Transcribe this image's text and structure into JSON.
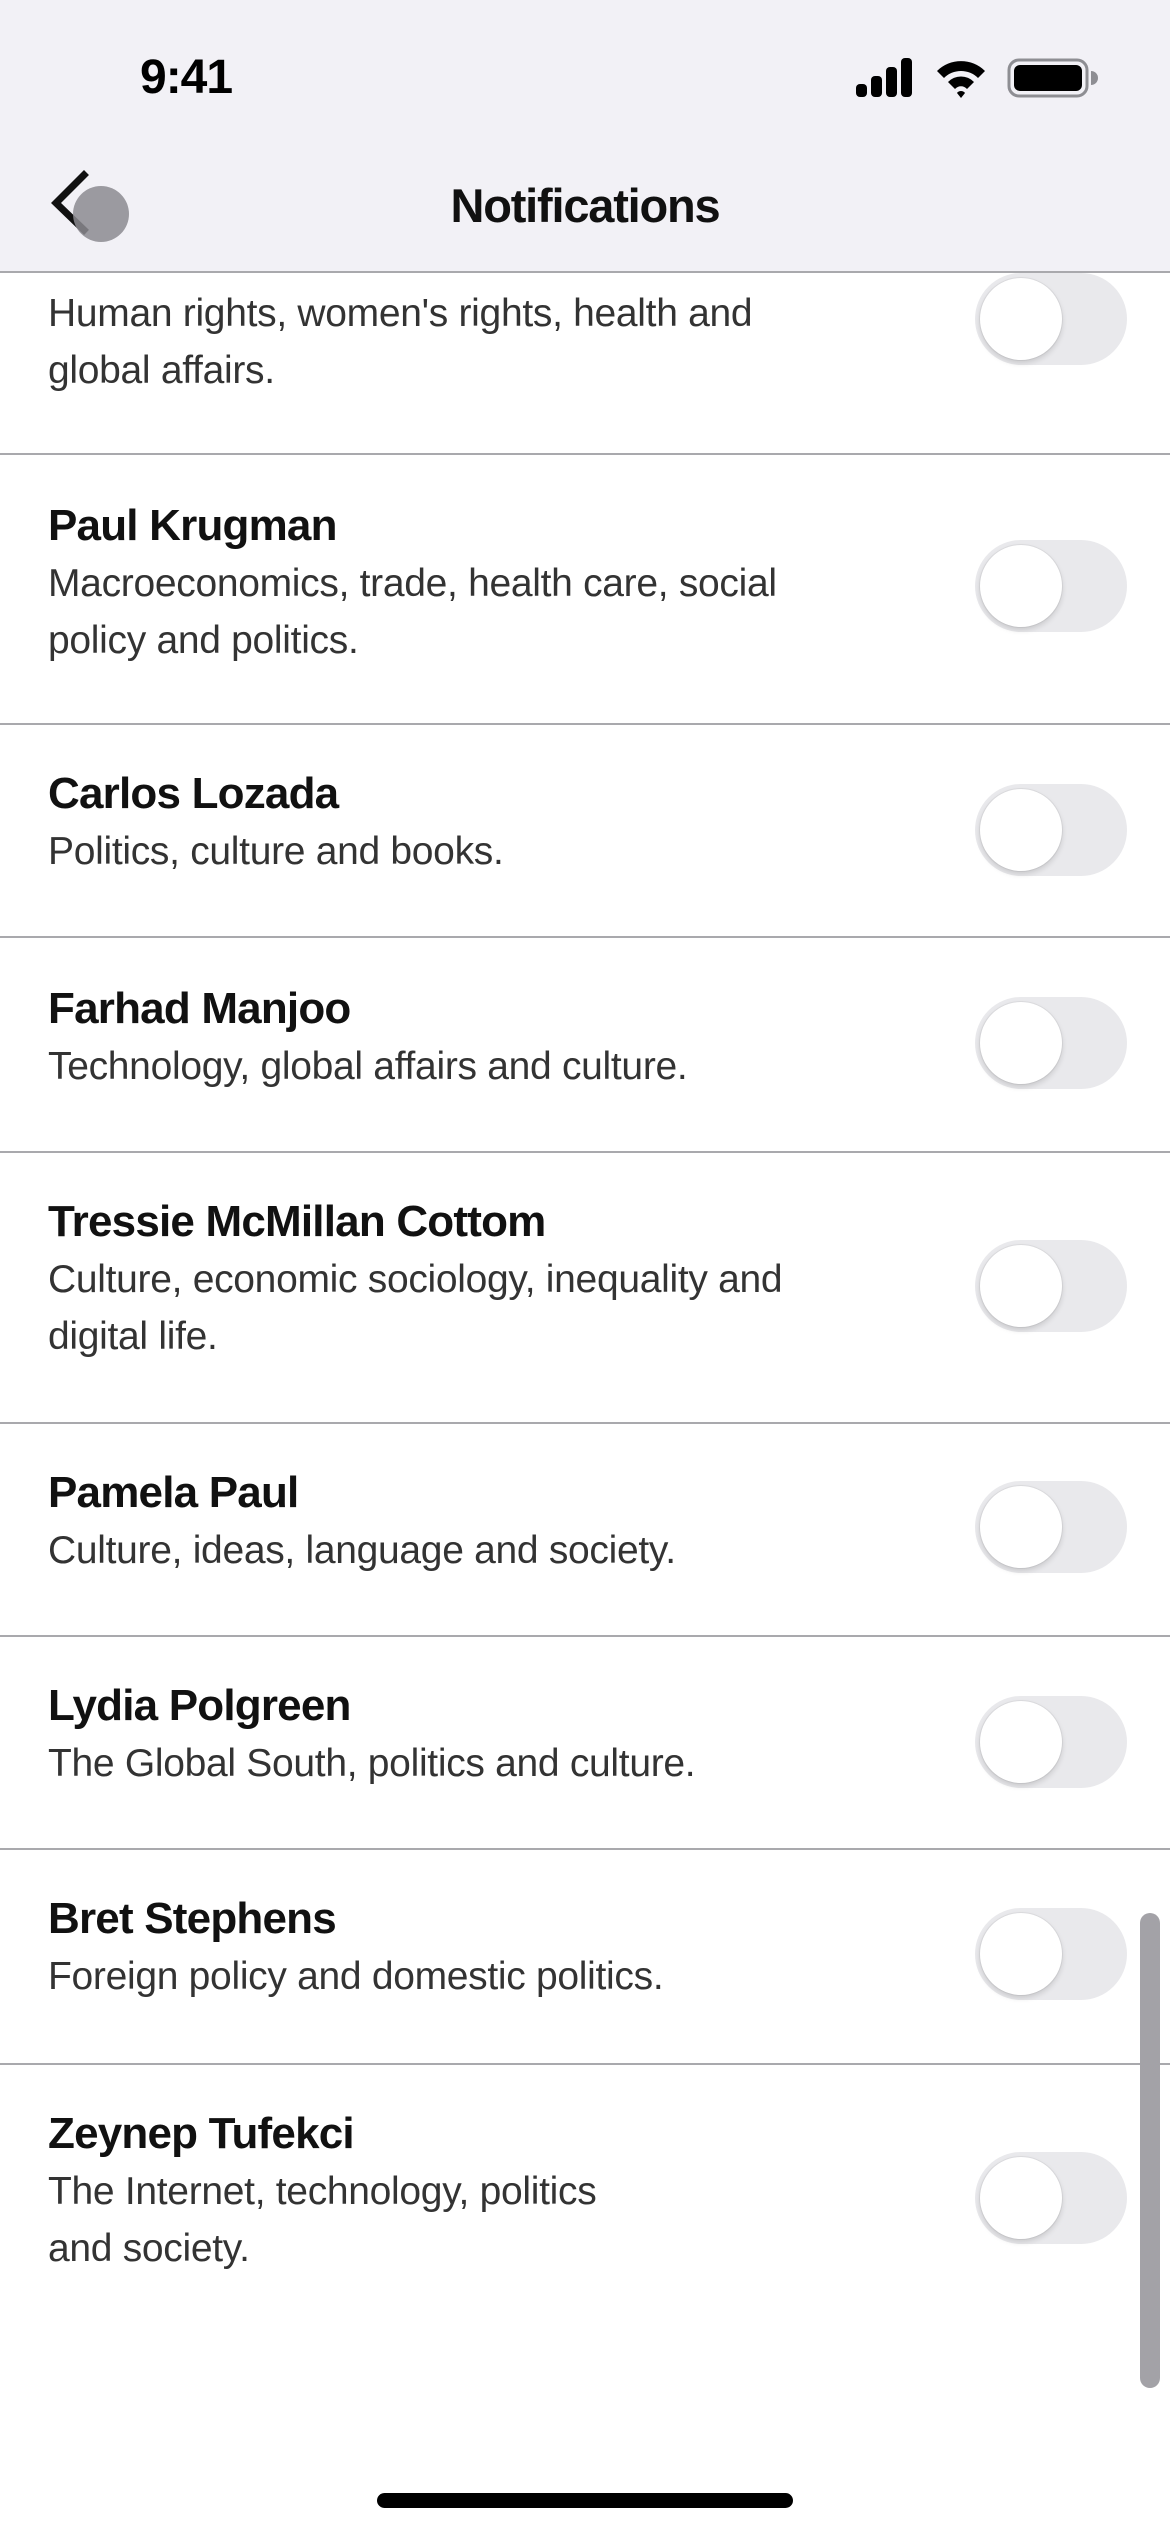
{
  "status_bar": {
    "time": "9:41",
    "icons": [
      "cellular-signal-icon",
      "wifi-icon",
      "battery-full-icon"
    ]
  },
  "nav": {
    "back_icon": "chevron-left-icon",
    "title": "Notifications"
  },
  "colors": {
    "toggle_off_track": "#e9e9ec",
    "toggle_knob": "#ffffff",
    "header_background": "#f2f1f6",
    "divider": "#a9a9ad",
    "scrollbar": "#a3a2a7"
  },
  "columnists": [
    {
      "name": "",
      "description_lines": [
        "Human rights, women's rights, health and",
        "global affairs."
      ],
      "enabled": false
    },
    {
      "name": "Paul Krugman",
      "description_lines": [
        "Macroeconomics, trade, health care, social",
        "policy and politics."
      ],
      "enabled": false
    },
    {
      "name": "Carlos Lozada",
      "description_lines": [
        "Politics, culture and books."
      ],
      "enabled": false
    },
    {
      "name": "Farhad Manjoo",
      "description_lines": [
        "Technology, global affairs and culture."
      ],
      "enabled": false
    },
    {
      "name": "Tressie McMillan Cottom",
      "description_lines": [
        "Culture, economic sociology, inequality and",
        "digital life."
      ],
      "enabled": false
    },
    {
      "name": "Pamela Paul",
      "description_lines": [
        "Culture, ideas, language and society."
      ],
      "enabled": false
    },
    {
      "name": "Lydia Polgreen",
      "description_lines": [
        "The Global South, politics and culture."
      ],
      "enabled": false
    },
    {
      "name": "Bret Stephens",
      "description_lines": [
        "Foreign policy and domestic politics."
      ],
      "enabled": false
    },
    {
      "name": "Zeynep Tufekci",
      "description_lines": [
        "The Internet, technology, politics",
        "and society."
      ],
      "enabled": false
    }
  ]
}
